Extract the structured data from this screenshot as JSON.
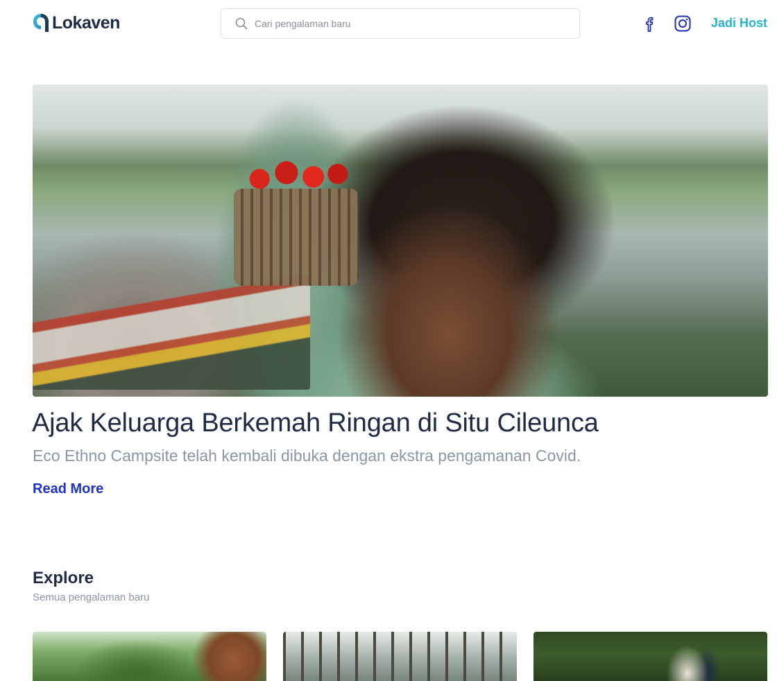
{
  "header": {
    "brand": "Lokaven",
    "search_placeholder": "Cari pengalaman baru",
    "host_label": "Jadi Host",
    "social_icons": [
      "facebook-icon",
      "instagram-icon"
    ],
    "accent_color": "#27b3d6",
    "brand_color": "#1f2a44"
  },
  "hero": {
    "title": "Ajak Keluarga Berkemah Ringan di Situ Cileunca",
    "subtitle": "Eco Ethno Campsite telah kembali dibuka dengan ekstra pengamanan Covid.",
    "read_more_label": "Read More",
    "link_color": "#1c2fc7"
  },
  "explore": {
    "title": "Explore",
    "subtitle": "Semua pengalaman baru",
    "cards": 3
  }
}
